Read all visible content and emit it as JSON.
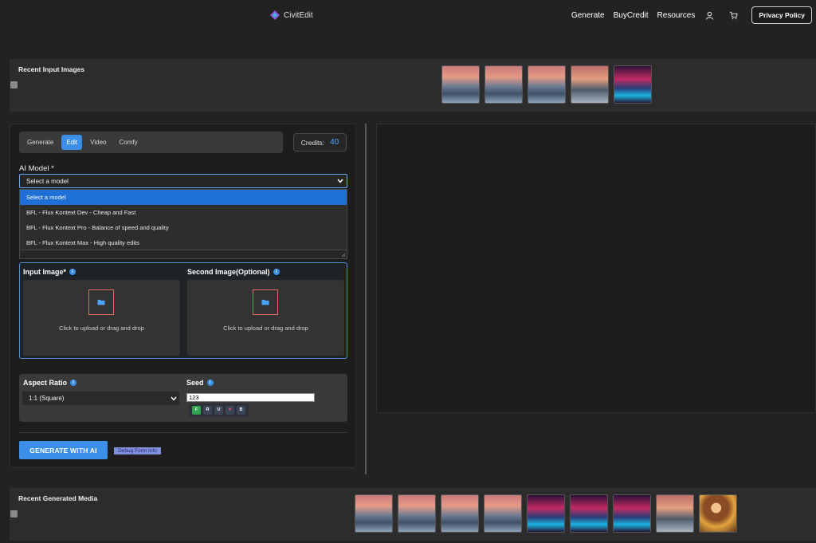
{
  "header": {
    "brand": "CivitEdit",
    "nav": [
      "Generate",
      "BuyCredit",
      "Resources"
    ],
    "privacy_label": "Privacy Policy",
    "icons": [
      "user-icon",
      "cart-icon"
    ]
  },
  "recent_input": {
    "title": "Recent Input Images",
    "thumbs": [
      "eagle",
      "eagle",
      "eagle",
      "valley",
      "city"
    ]
  },
  "tabs": [
    "Generate",
    "Edit",
    "Video",
    "Comfy"
  ],
  "active_tab": "Edit",
  "credits": {
    "label": "Credits:",
    "value": "40"
  },
  "model": {
    "label": "AI Model *",
    "selected": "Select a model",
    "options": [
      "Select a model",
      "BFL - Flux Kontext Dev - Cheap and Fast",
      "BFL - Flux Kontext Pro - Balance of speed and quality",
      "BFL - Flux Kontext Max - High quality edits"
    ]
  },
  "uploads": {
    "input_title": "Input Image*",
    "second_title": "Second Image(Optional)",
    "hint": "Click to upload or drag and drop"
  },
  "params": {
    "aspect_title": "Aspect Ratio",
    "aspect_value": "1:1 (Square)",
    "seed_title": "Seed",
    "seed_value": "123",
    "seed_buttons": [
      "F",
      "R",
      "U",
      "♥",
      "B"
    ]
  },
  "actions": {
    "generate": "GENERATE WITH AI",
    "debug": "Debug Form Info"
  },
  "recent_generated": {
    "title": "Recent Generated Media",
    "thumbs": [
      "eagle",
      "eagle",
      "eagle",
      "eagle",
      "city",
      "city",
      "city",
      "valley",
      "girl"
    ]
  },
  "colors": {
    "accent": "#3b8fe8",
    "background": "#222222",
    "panel": "#1d1d1d"
  }
}
